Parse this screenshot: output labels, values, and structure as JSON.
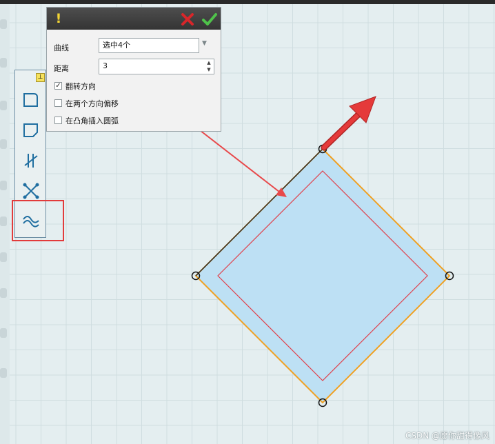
{
  "panel": {
    "warning_icon": "exclamation-icon",
    "curve_label": "曲线",
    "curve_value": "选中4个",
    "distance_label": "距离",
    "distance_value": "3",
    "options": [
      {
        "label": "翻转方向",
        "checked": true
      },
      {
        "label": "在两个方向偏移",
        "checked": false
      },
      {
        "label": "在凸角插入圆弧",
        "checked": false
      }
    ]
  },
  "toolbar": {
    "tools": [
      "offset-curve-icon",
      "curve-chamfer-icon",
      "trim-curve-icon",
      "curve-intersect-icon",
      "curve-offset-wave-icon"
    ],
    "selected_tool_index": 4
  },
  "colors": {
    "accent_orange": "#f0a020",
    "offset_red": "#e0404a",
    "shape_fill": "#bde0f4",
    "arrow_red": "#e53a3a",
    "highlight_red": "#e23b3b"
  },
  "watermark": "CSDN @愿你甜得像风"
}
